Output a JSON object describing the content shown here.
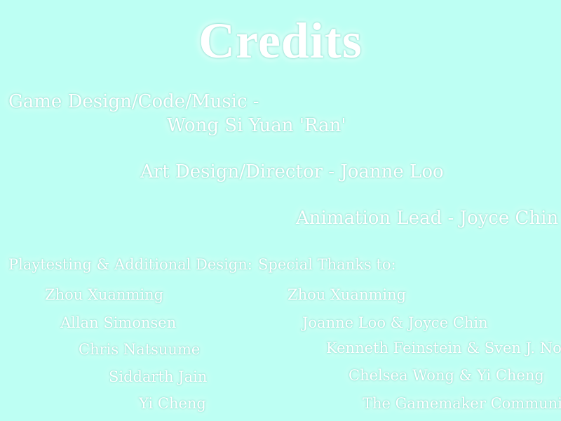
{
  "screen": {
    "title": "Credits",
    "background_color": "#bdfff3",
    "text_color": "#ffffff"
  },
  "roles": {
    "game_design_label": "Game Design/Code/Music  -",
    "game_design_name": "Wong Si Yuan 'Ran'",
    "art_design": "Art Design/Director - Joanne Loo",
    "animation": "Animation Lead - Joyce Chin"
  },
  "playtesting": {
    "heading": "Playtesting & Additional Design:",
    "names": [
      "Zhou Xuanming",
      "Allan Simonsen",
      "Chris Natsuume",
      "Siddarth Jain",
      "Yi Cheng"
    ]
  },
  "special_thanks": {
    "heading": "Special Thanks to:",
    "names": [
      "Zhou Xuanming",
      "Joanne Loo & Joyce Chin",
      "Kenneth Feinstein & Sven J. Norris",
      "Chelsea Wong & Yi Cheng",
      "The Gamemaker Community"
    ]
  }
}
